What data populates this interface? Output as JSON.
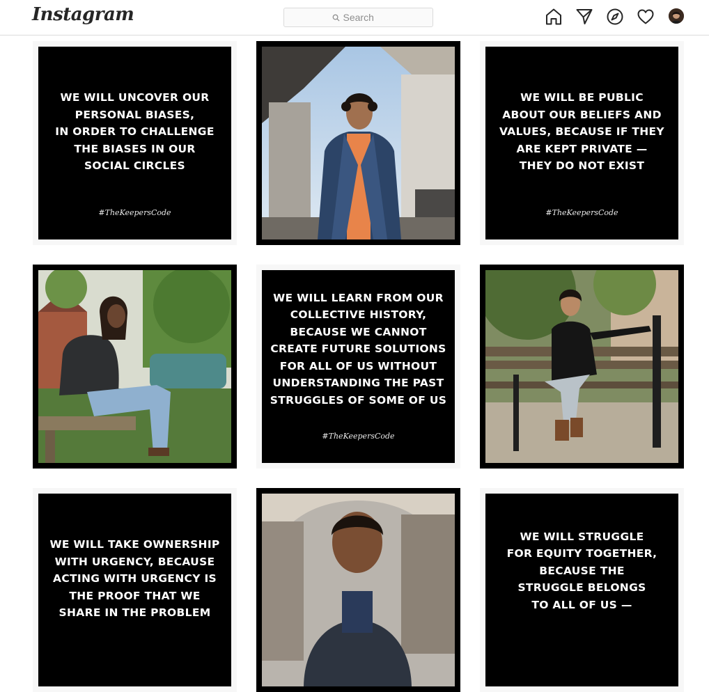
{
  "header": {
    "logo": "Instagram",
    "search": {
      "placeholder": "Search"
    },
    "nav": [
      {
        "name": "home-icon"
      },
      {
        "name": "direct-icon"
      },
      {
        "name": "explore-icon"
      },
      {
        "name": "activity-icon"
      },
      {
        "name": "profile-avatar"
      }
    ]
  },
  "posts": [
    {
      "kind": "quote",
      "text": "We will uncover our\npersonal biases,\nin order to challenge\nthe biases in our\nsocial circles",
      "tag": "#TheKeepersCode"
    },
    {
      "kind": "photo",
      "subject": "young man in denim jacket under an overpass"
    },
    {
      "kind": "quote",
      "text": "We will be public\nabout our beliefs and\nvalues, because if they\nare kept private —\nthey do not exist",
      "tag": "#TheKeepersCode"
    },
    {
      "kind": "photo",
      "subject": "man with locs seated in a garden"
    },
    {
      "kind": "quote",
      "text": "We will learn from our\ncollective history,\nbecause we cannot\ncreate future solutions\nfor all of us without\nunderstanding the past\nstruggles of some of us",
      "tag": "#TheKeepersCode"
    },
    {
      "kind": "photo",
      "subject": "man on a park bench"
    },
    {
      "kind": "quote",
      "text": "We will take ownership\nwith urgency, because\nacting with urgency is\nthe proof that we\nshare in the problem",
      "tag": ""
    },
    {
      "kind": "photo",
      "subject": "man in front of an archway"
    },
    {
      "kind": "quote",
      "text": "We will struggle\nfor equity together,\nbecause the\nstruggle belongs\nto all of us —",
      "tag": ""
    }
  ],
  "colors": {
    "border": "#dbdbdb",
    "icon": "#262626",
    "placeholder": "#8e8e8e"
  }
}
